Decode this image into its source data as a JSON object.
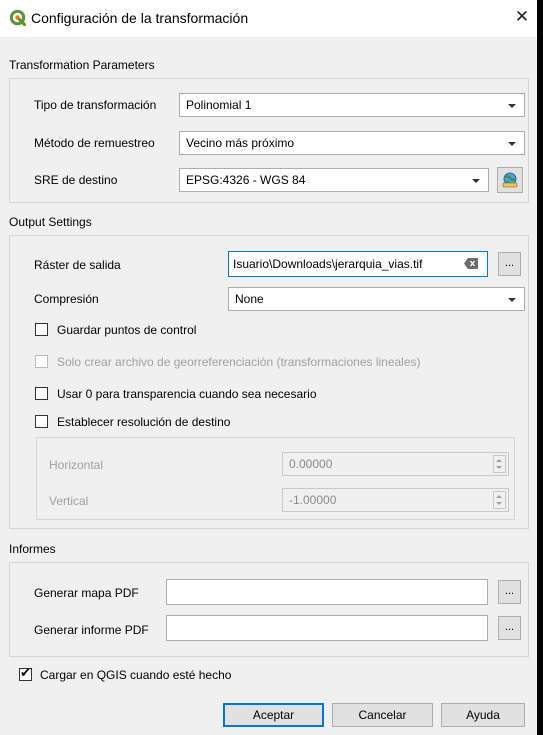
{
  "window": {
    "title": "Configuración de la transformación",
    "close_glyph": "✕",
    "app_icon": "qgis-logo-icon"
  },
  "transformation": {
    "heading": "Transformation Parameters",
    "type_label": "Tipo de transformación",
    "type_value": "Polinomial 1",
    "resample_label": "Método de remuestreo",
    "resample_value": "Vecino más próximo",
    "crs_label": "SRE de destino",
    "crs_value": "EPSG:4326 - WGS 84",
    "crs_button_icon": "projection-globe-icon"
  },
  "output": {
    "heading": "Output Settings",
    "raster_label": "Ráster de salida",
    "raster_value": "Isuario\\Downloads\\jerarquia_vias.tif",
    "browse_label": "...",
    "compression_label": "Compresión",
    "compression_value": "None",
    "save_gcp_label": "Guardar puntos de control",
    "worldfile_label": "Solo crear archivo de georreferenciación (transformaciones lineales)",
    "zero_transparency_label": "Usar 0 para transparencia cuando sea necesario",
    "target_res_label": "Establecer resolución de destino",
    "horizontal_label": "Horizontal",
    "horizontal_value": "0.00000",
    "vertical_label": "Vertical",
    "vertical_value": "-1.00000"
  },
  "reports": {
    "heading": "Informes",
    "pdf_map_label": "Generar mapa PDF",
    "pdf_map_value": "",
    "pdf_report_label": "Generar informe PDF",
    "pdf_report_value": "",
    "browse_label": "..."
  },
  "load_in_qgis_label": "Cargar en QGIS cuando esté hecho",
  "load_in_qgis_checked": true,
  "buttons": {
    "ok": "Aceptar",
    "cancel": "Cancelar",
    "help": "Ayuda"
  },
  "colors": {
    "accent": "#0078d7",
    "qgis_green": "#589632",
    "qgis_yellow": "#ee7913"
  }
}
